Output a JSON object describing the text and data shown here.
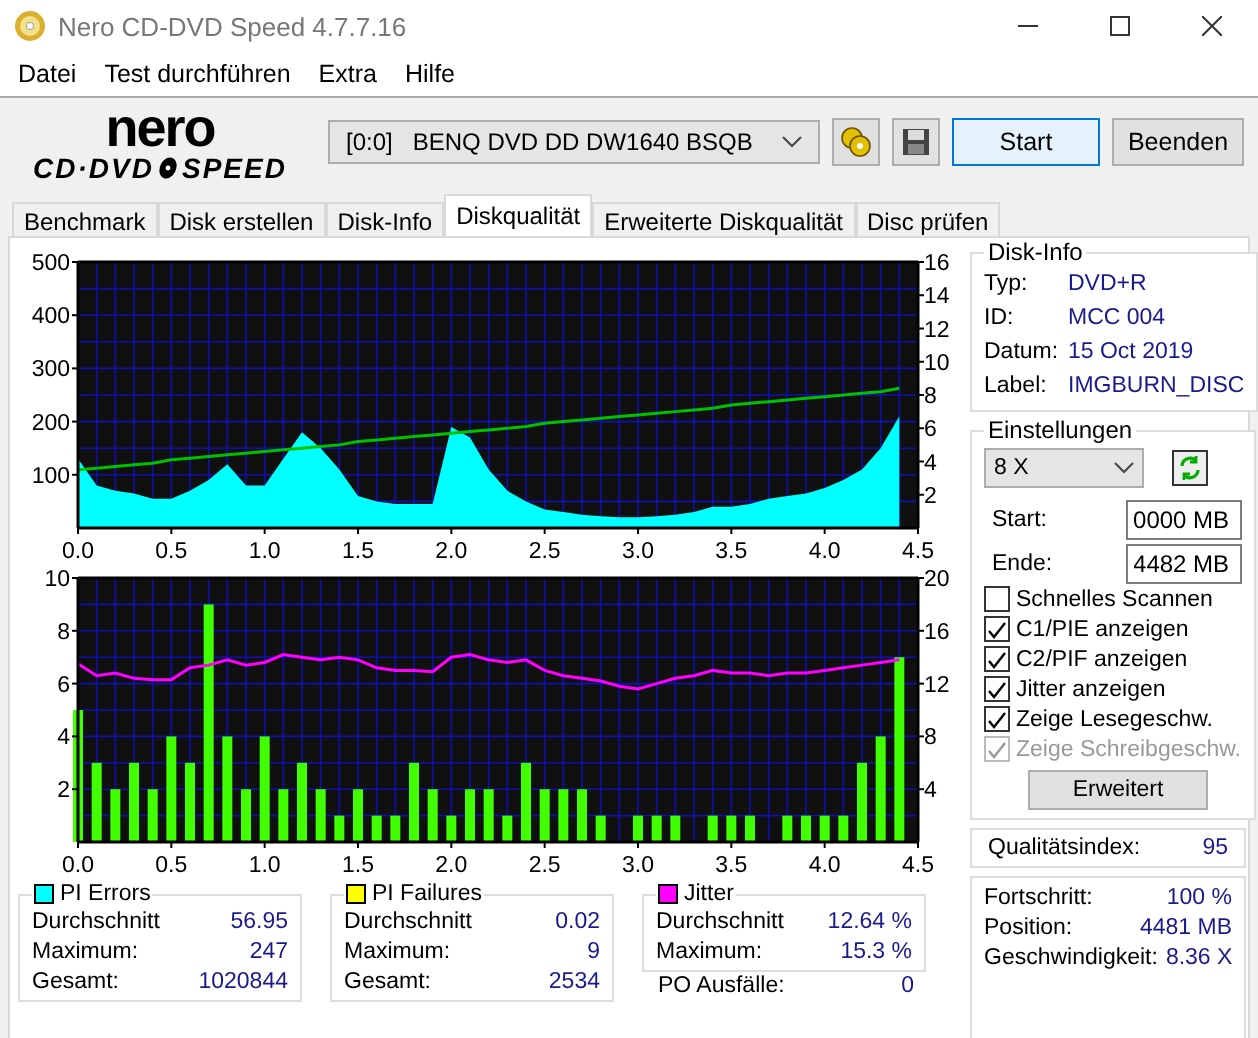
{
  "window": {
    "title": "Nero CD-DVD Speed 4.7.7.16"
  },
  "menu": [
    "Datei",
    "Test durchführen",
    "Extra",
    "Hilfe"
  ],
  "logo": {
    "word": "nero",
    "left": "CD·DVD",
    "right": "SPEED"
  },
  "toolbar": {
    "drive": "[0:0]   BENQ DVD DD DW1640 BSQB",
    "buttons": [
      "Start",
      "Beenden"
    ]
  },
  "tabs": [
    {
      "label": "Benchmark",
      "selected": false
    },
    {
      "label": "Disk erstellen",
      "selected": false
    },
    {
      "label": "Disk-Info",
      "selected": false
    },
    {
      "label": "Diskqualität",
      "selected": true
    },
    {
      "label": "Erweiterte Diskqualität",
      "selected": false
    },
    {
      "label": "Disc prüfen",
      "selected": false
    }
  ],
  "charts": [
    {
      "chart_data": {
        "type": "area",
        "grid": true,
        "x": [
          0,
          0.1,
          0.2,
          0.3,
          0.4,
          0.5,
          0.6,
          0.7,
          0.8,
          0.9,
          1.0,
          1.1,
          1.2,
          1.3,
          1.4,
          1.5,
          1.6,
          1.7,
          1.8,
          1.9,
          2.0,
          2.1,
          2.2,
          2.3,
          2.4,
          2.5,
          2.6,
          2.7,
          2.8,
          2.9,
          3.0,
          3.1,
          3.2,
          3.3,
          3.4,
          3.5,
          3.6,
          3.7,
          3.8,
          3.9,
          4.0,
          4.1,
          4.2,
          4.3,
          4.4
        ],
        "xlim": [
          0,
          4.5
        ],
        "ylim": [
          0,
          500
        ],
        "y2lim": [
          0,
          16
        ],
        "xticks": [
          {
            "value": 0,
            "label": "0.0"
          },
          {
            "value": 0.5,
            "label": "0.5"
          },
          {
            "value": 1,
            "label": "1.0"
          },
          {
            "value": 1.5,
            "label": "1.5"
          },
          {
            "value": 2,
            "label": "2.0"
          },
          {
            "value": 2.5,
            "label": "2.5"
          },
          {
            "value": 3,
            "label": "3.0"
          },
          {
            "value": 3.5,
            "label": "3.5"
          },
          {
            "value": 4,
            "label": "4.0"
          },
          {
            "value": 4.5,
            "label": "4.5"
          }
        ],
        "yticks": [
          100,
          200,
          300,
          400,
          500
        ],
        "y2ticks": [
          2,
          4,
          6,
          8,
          10,
          12,
          14,
          16
        ],
        "series": [
          {
            "color": "#00ffff",
            "values": [
              130,
              80,
              70,
              65,
              55,
              55,
              70,
              90,
              120,
              80,
              80,
              130,
              180,
              150,
              110,
              60,
              50,
              45,
              45,
              45,
              190,
              170,
              110,
              70,
              50,
              35,
              30,
              25,
              22,
              20,
              20,
              22,
              25,
              30,
              40,
              40,
              45,
              55,
              60,
              65,
              75,
              90,
              110,
              150,
              210
            ]
          },
          {
            "type": "line",
            "color": "#00c000",
            "axis": "y2",
            "values": [
              3.5,
              3.6,
              3.7,
              3.8,
              3.9,
              4.1,
              4.2,
              4.3,
              4.4,
              4.5,
              4.6,
              4.7,
              4.8,
              4.9,
              5.0,
              5.2,
              5.3,
              5.4,
              5.5,
              5.6,
              5.7,
              5.8,
              5.9,
              6.0,
              6.1,
              6.3,
              6.4,
              6.5,
              6.6,
              6.7,
              6.8,
              6.9,
              7.0,
              7.1,
              7.2,
              7.4,
              7.5,
              7.6,
              7.7,
              7.8,
              7.9,
              8.0,
              8.1,
              8.2,
              8.4
            ]
          }
        ]
      }
    },
    {
      "chart_data": {
        "type": "bar",
        "grid": true,
        "x": [
          0,
          0.1,
          0.2,
          0.3,
          0.4,
          0.5,
          0.6,
          0.7,
          0.8,
          0.9,
          1.0,
          1.1,
          1.2,
          1.3,
          1.4,
          1.5,
          1.6,
          1.7,
          1.8,
          1.9,
          2.0,
          2.1,
          2.2,
          2.3,
          2.4,
          2.5,
          2.6,
          2.7,
          2.8,
          2.9,
          3.0,
          3.1,
          3.2,
          3.3,
          3.4,
          3.5,
          3.6,
          3.7,
          3.8,
          3.9,
          4.0,
          4.1,
          4.2,
          4.3,
          4.4
        ],
        "xlim": [
          0,
          4.5
        ],
        "ylim": [
          0,
          10
        ],
        "y2lim": [
          0,
          20
        ],
        "xticks": [
          {
            "value": 0,
            "label": "0.0"
          },
          {
            "value": 0.5,
            "label": "0.5"
          },
          {
            "value": 1,
            "label": "1.0"
          },
          {
            "value": 1.5,
            "label": "1.5"
          },
          {
            "value": 2,
            "label": "2.0"
          },
          {
            "value": 2.5,
            "label": "2.5"
          },
          {
            "value": 3,
            "label": "3.0"
          },
          {
            "value": 3.5,
            "label": "3.5"
          },
          {
            "value": 4,
            "label": "4.0"
          },
          {
            "value": 4.5,
            "label": "4.5"
          }
        ],
        "yticks": [
          2,
          4,
          6,
          8,
          10
        ],
        "y2ticks": [
          4,
          8,
          12,
          16,
          20
        ],
        "series": [
          {
            "color": "#40ff00",
            "values": [
              5,
              3,
              2,
              3,
              2,
              4,
              3,
              9,
              4,
              2,
              4,
              2,
              3,
              2,
              1,
              2,
              1,
              1,
              3,
              2,
              1,
              2,
              2,
              1,
              3,
              2,
              2,
              2,
              1,
              0,
              1,
              1,
              1,
              0,
              1,
              1,
              1,
              0,
              1,
              1,
              1,
              1,
              3,
              4,
              7
            ]
          },
          {
            "type": "line",
            "color": "#ff00ff",
            "axis": "y2",
            "values": [
              13.5,
              12.6,
              12.8,
              12.4,
              12.3,
              12.3,
              13.2,
              13.4,
              13.8,
              13.4,
              13.6,
              14.2,
              14.0,
              13.8,
              14.0,
              13.8,
              13.2,
              13.0,
              13.0,
              12.9,
              14.0,
              14.2,
              13.8,
              13.6,
              13.8,
              13.0,
              12.6,
              12.4,
              12.2,
              11.8,
              11.6,
              12.0,
              12.4,
              12.6,
              13.0,
              12.8,
              12.8,
              12.6,
              12.8,
              12.8,
              13.0,
              13.2,
              13.4,
              13.6,
              13.8
            ]
          }
        ]
      }
    }
  ],
  "disk_info": {
    "title": "Disk-Info",
    "rows": [
      {
        "label": "Typ:",
        "value": "DVD+R"
      },
      {
        "label": "ID:",
        "value": "MCC 004"
      },
      {
        "label": "Datum:",
        "value": "15 Oct 2019"
      },
      {
        "label": "Label:",
        "value": "IMGBURN_DISC"
      }
    ]
  },
  "settings": {
    "title": "Einstellungen",
    "speed": "8 X",
    "start": {
      "label": "Start:",
      "value": "0000 MB"
    },
    "end": {
      "label": "Ende:",
      "value": "4482 MB"
    },
    "checkboxes": [
      {
        "label": "Schnelles Scannen",
        "checked": false,
        "disabled": false
      },
      {
        "label": "C1/PIE anzeigen",
        "checked": true,
        "disabled": false
      },
      {
        "label": "C2/PIF anzeigen",
        "checked": true,
        "disabled": false
      },
      {
        "label": "Jitter anzeigen",
        "checked": true,
        "disabled": false
      },
      {
        "label": "Zeige Lesegeschw.",
        "checked": true,
        "disabled": false
      },
      {
        "label": "Zeige Schreibgeschw.",
        "checked": true,
        "disabled": true
      }
    ],
    "button": "Erweitert"
  },
  "quality": {
    "label": "Qualitätsindex:",
    "value": "95"
  },
  "stats": [
    {
      "title": "PI Errors",
      "color": "#00ffff",
      "rows": [
        {
          "label": "Durchschnitt",
          "value": "56.95"
        },
        {
          "label": "Maximum:",
          "value": "247"
        },
        {
          "label": "Gesamt:",
          "value": "1020844"
        }
      ]
    },
    {
      "title": "PI Failures",
      "color": "#ffff00",
      "rows": [
        {
          "label": "Durchschnitt",
          "value": "0.02"
        },
        {
          "label": "Maximum:",
          "value": "9"
        },
        {
          "label": "Gesamt:",
          "value": "2534"
        }
      ]
    },
    {
      "title": "Jitter",
      "color": "#ff00ff",
      "rows": [
        {
          "label": "Durchschnitt",
          "value": "12.64 %"
        },
        {
          "label": "Maximum:",
          "value": "15.3 %"
        }
      ]
    }
  ],
  "po_failures": {
    "label": "PO Ausfälle:",
    "value": "0"
  },
  "progress": [
    {
      "label": "Fortschritt:",
      "value": "100 %"
    },
    {
      "label": "Position:",
      "value": "4481 MB"
    },
    {
      "label": "Geschwindigkeit:",
      "value": "8.36 X"
    }
  ]
}
